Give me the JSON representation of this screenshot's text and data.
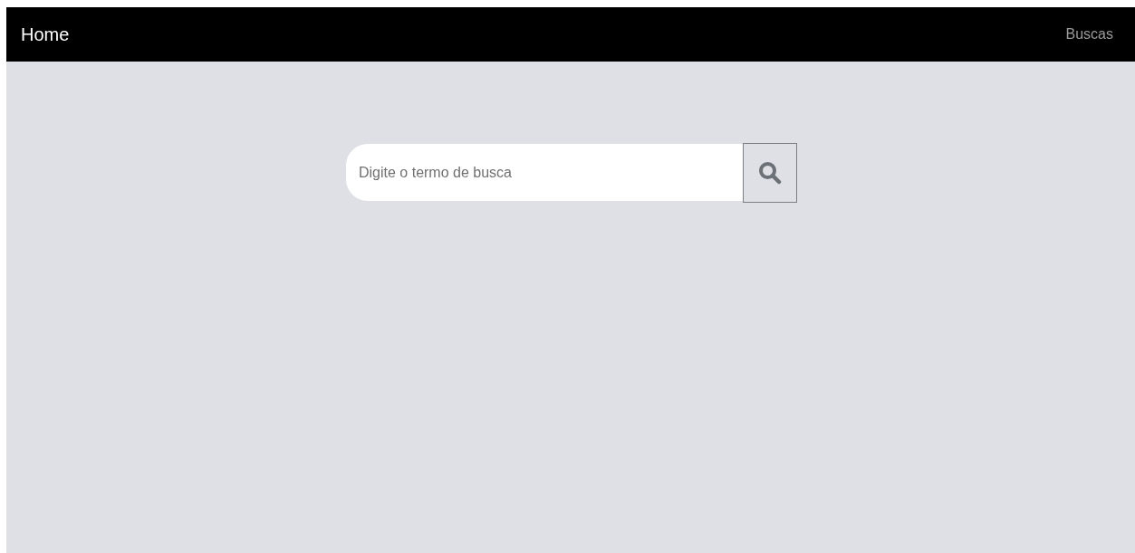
{
  "navbar": {
    "brand": "Home",
    "links": [
      "Buscas"
    ]
  },
  "search": {
    "placeholder": "Digite o termo de busca"
  }
}
